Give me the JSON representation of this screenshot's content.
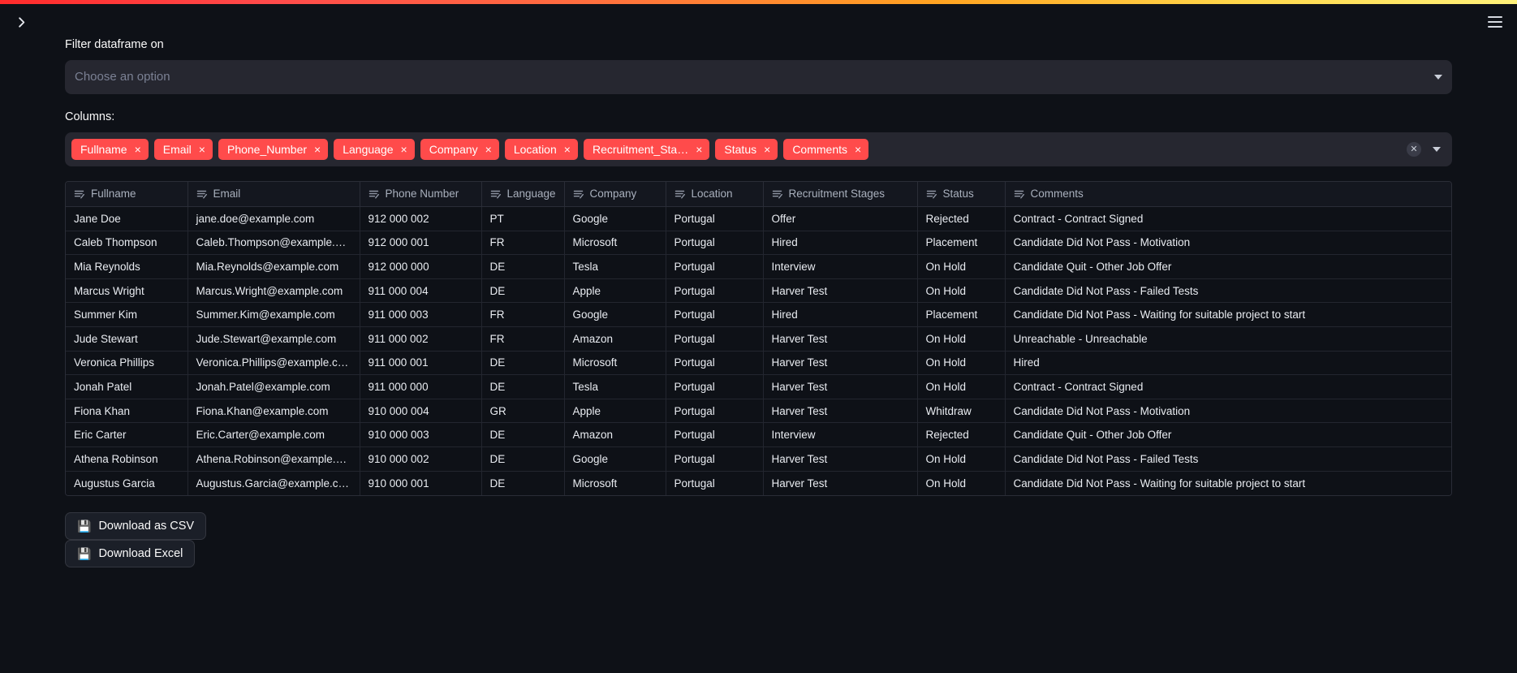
{
  "header": {
    "sidebar_toggle_icon": "chevron-right-icon",
    "menu_icon": "hamburger-menu-icon"
  },
  "filter": {
    "label": "Filter dataframe on",
    "select_placeholder": "Choose an option",
    "dropdown_icon": "chevron-down-icon"
  },
  "columns_select": {
    "label": "Columns:",
    "clear_icon": "clear-circle-icon",
    "dropdown_icon": "chevron-down-icon",
    "chips": [
      {
        "label": "Fullname",
        "remove": "×"
      },
      {
        "label": "Email",
        "remove": "×"
      },
      {
        "label": "Phone_Number",
        "remove": "×"
      },
      {
        "label": "Language",
        "remove": "×"
      },
      {
        "label": "Company",
        "remove": "×"
      },
      {
        "label": "Location",
        "remove": "×"
      },
      {
        "label": "Recruitment_Sta…",
        "remove": "×"
      },
      {
        "label": "Status",
        "remove": "×"
      },
      {
        "label": "Comments",
        "remove": "×"
      }
    ]
  },
  "table": {
    "column_header_icon": "text-column-icon",
    "headers": [
      "Fullname",
      "Email",
      "Phone Number",
      "Language",
      "Company",
      "Location",
      "Recruitment Stages",
      "Status",
      "Comments"
    ],
    "rows": [
      [
        "Jane Doe",
        "jane.doe@example.com",
        "912 000 002",
        "PT",
        "Google",
        "Portugal",
        "Offer",
        "Rejected",
        "Contract - Contract Signed"
      ],
      [
        "Caleb Thompson",
        "Caleb.Thompson@example.com",
        "912 000 001",
        "FR",
        "Microsoft",
        "Portugal",
        "Hired",
        "Placement",
        "Candidate Did Not Pass - Motivation"
      ],
      [
        "Mia Reynolds",
        "Mia.Reynolds@example.com",
        "912 000 000",
        "DE",
        "Tesla",
        "Portugal",
        "Interview",
        "On Hold",
        "Candidate Quit - Other Job Offer"
      ],
      [
        "Marcus Wright",
        "Marcus.Wright@example.com",
        "911 000 004",
        "DE",
        "Apple",
        "Portugal",
        "Harver Test",
        "On Hold",
        "Candidate Did Not Pass - Failed Tests"
      ],
      [
        "Summer Kim",
        "Summer.Kim@example.com",
        "911 000 003",
        "FR",
        "Google",
        "Portugal",
        "Hired",
        "Placement",
        "Candidate Did Not Pass - Waiting for suitable project to start"
      ],
      [
        "Jude Stewart",
        "Jude.Stewart@example.com",
        "911 000 002",
        "FR",
        "Amazon",
        "Portugal",
        "Harver Test",
        "On Hold",
        "Unreachable - Unreachable"
      ],
      [
        "Veronica Phillips",
        "Veronica.Phillips@example.com",
        "911 000 001",
        "DE",
        "Microsoft",
        "Portugal",
        "Harver Test",
        "On Hold",
        "Hired"
      ],
      [
        "Jonah Patel",
        "Jonah.Patel@example.com",
        "911 000 000",
        "DE",
        "Tesla",
        "Portugal",
        "Harver Test",
        "On Hold",
        "Contract - Contract Signed"
      ],
      [
        "Fiona Khan",
        "Fiona.Khan@example.com",
        "910 000 004",
        "GR",
        "Apple",
        "Portugal",
        "Harver Test",
        "Whitdraw",
        "Candidate Did Not Pass - Motivation"
      ],
      [
        "Eric Carter",
        "Eric.Carter@example.com",
        "910 000 003",
        "DE",
        "Amazon",
        "Portugal",
        "Interview",
        "Rejected",
        "Candidate Quit - Other Job Offer"
      ],
      [
        "Athena Robinson",
        "Athena.Robinson@example.com",
        "910 000 002",
        "DE",
        "Google",
        "Portugal",
        "Harver Test",
        "On Hold",
        "Candidate Did Not Pass - Failed Tests"
      ],
      [
        "Augustus Garcia",
        "Augustus.Garcia@example.com",
        "910 000 001",
        "DE",
        "Microsoft",
        "Portugal",
        "Harver Test",
        "On Hold",
        "Candidate Did Not Pass - Waiting for suitable project to start"
      ]
    ]
  },
  "actions": {
    "download_csv": {
      "label": "Download as CSV",
      "icon": "💾"
    },
    "download_excel": {
      "label": "Download Excel",
      "icon": "💾"
    }
  },
  "colors": {
    "accent": "#ff4b4b",
    "background": "#0e1117",
    "surface": "#262730",
    "text": "#fafafa"
  }
}
